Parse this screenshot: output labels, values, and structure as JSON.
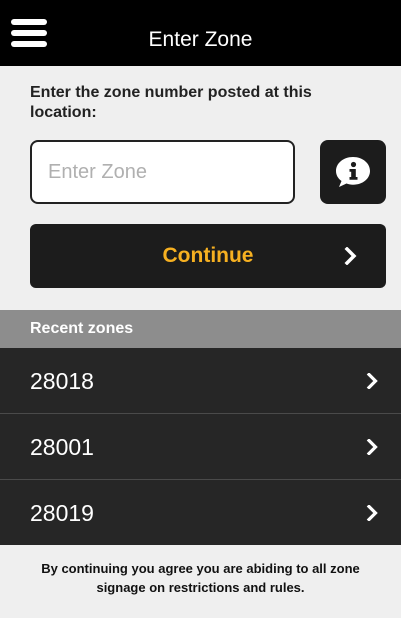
{
  "header": {
    "title": "Enter Zone",
    "menu_icon": "hamburger-menu-icon"
  },
  "instructions": {
    "text": "Enter the zone number posted at this location:"
  },
  "zone_input": {
    "value": "",
    "placeholder": "Enter Zone"
  },
  "info_button": {
    "icon": "info-speech-bubble-icon"
  },
  "continue_button": {
    "label": "Continue",
    "icon": "chevron-right-icon"
  },
  "recent": {
    "header": "Recent zones",
    "items": [
      {
        "zone": "28018"
      },
      {
        "zone": "28001"
      },
      {
        "zone": "28019"
      }
    ]
  },
  "footer": {
    "text": "By continuing you agree you are abiding to all zone signage on restrictions and rules."
  },
  "colors": {
    "header_bg": "#000000",
    "accent": "#f6b021",
    "button_bg": "#1c1c1c",
    "row_bg": "#262626",
    "section_header_bg": "#8d8d8d",
    "page_bg": "#efefef"
  }
}
